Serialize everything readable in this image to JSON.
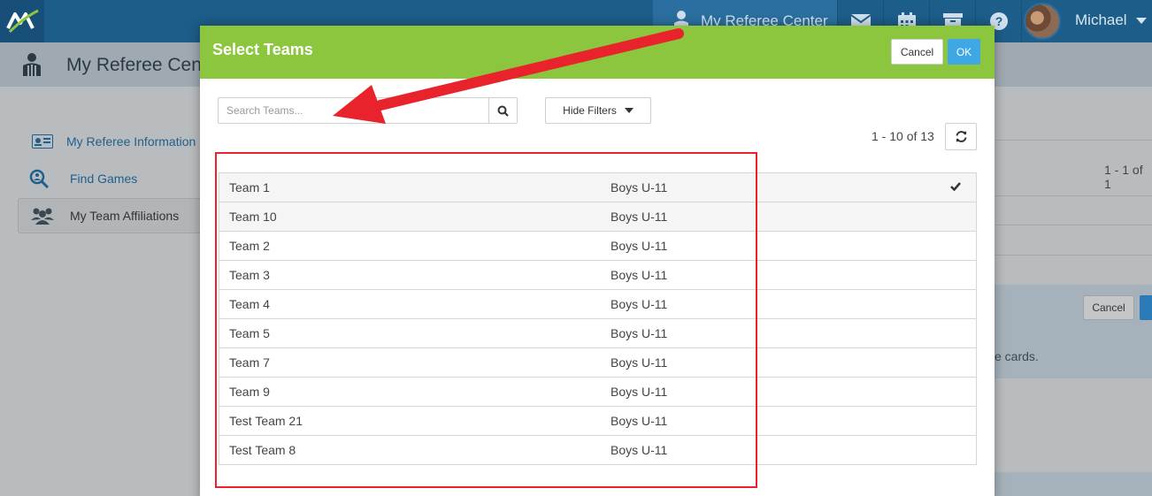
{
  "app": {
    "logo_icon": "app-logo-icon",
    "nav_center_label": "My Referee Center",
    "nav_icons": [
      "envelope-icon",
      "calendar-icon",
      "archive-icon",
      "help-icon"
    ],
    "user_name": "Michael",
    "page_title": "My Referee Center"
  },
  "sidebar": {
    "items": [
      {
        "label": "My Referee Information",
        "icon": "id-card-icon"
      },
      {
        "label": "Find Games",
        "icon": "search-users-icon"
      },
      {
        "label": "My Team Affiliations",
        "icon": "users-icon"
      }
    ]
  },
  "background": {
    "count_text": "1 - 1 of 1",
    "cancel_label": "Cancel",
    "cards_text": "e cards."
  },
  "modal": {
    "title": "Select Teams",
    "cancel_label": "Cancel",
    "ok_label": "OK",
    "search_placeholder": "Search Teams...",
    "search_value": "",
    "filters_label": "Hide Filters",
    "pagination": "1 - 10 of 13",
    "teams": [
      {
        "name": "Team 1",
        "division": "Boys U-11",
        "selected": true
      },
      {
        "name": "Team 10",
        "division": "Boys U-11",
        "selected": false
      },
      {
        "name": "Team 2",
        "division": "Boys U-11",
        "selected": false
      },
      {
        "name": "Team 3",
        "division": "Boys U-11",
        "selected": false
      },
      {
        "name": "Team 4",
        "division": "Boys U-11",
        "selected": false
      },
      {
        "name": "Team 5",
        "division": "Boys U-11",
        "selected": false
      },
      {
        "name": "Team 7",
        "division": "Boys U-11",
        "selected": false
      },
      {
        "name": "Team 9",
        "division": "Boys U-11",
        "selected": false
      },
      {
        "name": "Test Team 21",
        "division": "Boys U-11",
        "selected": false
      },
      {
        "name": "Test Team 8",
        "division": "Boys U-11",
        "selected": false
      }
    ]
  },
  "colors": {
    "header_green": "#8cc63f",
    "ok_blue": "#3ea8e5",
    "annotation_red": "#e8232b",
    "topbar_blue": "#1d5d8a"
  }
}
